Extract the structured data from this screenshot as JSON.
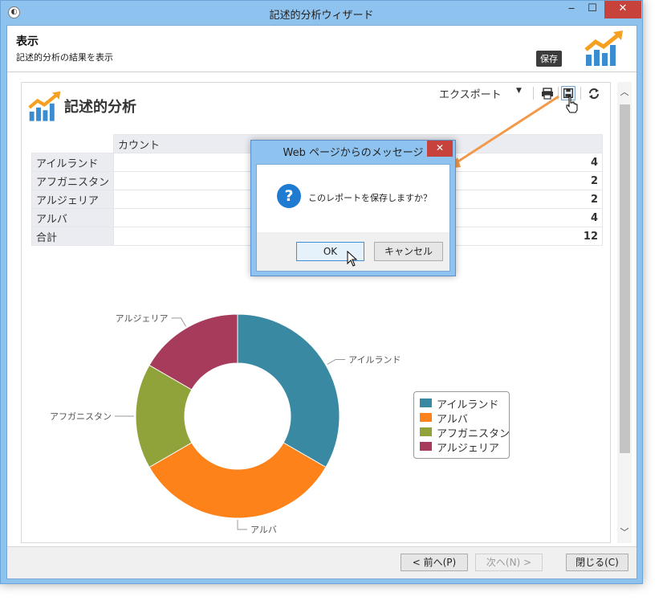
{
  "window": {
    "title": "記述的分析ウィザード",
    "minimize_glyph": "‒",
    "maximize_glyph": "☐",
    "close_glyph": "✕"
  },
  "header": {
    "title": "表示",
    "subtitle": "記述的分析の結果を表示",
    "logo_icon": "chart-trend-icon"
  },
  "toolbar": {
    "export_label": "エクスポート",
    "print_icon": "printer-icon",
    "save_icon": "floppy-disk-icon",
    "refresh_icon": "refresh-icon",
    "save_tooltip": "保存"
  },
  "report": {
    "title": "記述的分析",
    "column_header": "カウント",
    "rows": [
      {
        "label": "アイルランド",
        "value": "4"
      },
      {
        "label": "アフガニスタン",
        "value": "2"
      },
      {
        "label": "アルジェリア",
        "value": "2"
      },
      {
        "label": "アルバ",
        "value": "4"
      },
      {
        "label": "合計",
        "value": "12"
      }
    ]
  },
  "chart_data": {
    "type": "pie",
    "donut": true,
    "title": "",
    "categories": [
      "アイルランド",
      "アルバ",
      "アフガニスタン",
      "アルジェリア"
    ],
    "values": [
      4,
      4,
      2,
      2
    ],
    "colors": [
      "#3a89a3",
      "#fd8219",
      "#8fa33a",
      "#a63b5c"
    ],
    "legend_placement": "right"
  },
  "dialog": {
    "title": "Web ページからのメッセージ",
    "close_glyph": "✕",
    "message": "このレポートを保存しますか？",
    "ok_label": "OK",
    "cancel_label": "キャンセル"
  },
  "footer": {
    "prev_label": "< 前へ(P)",
    "next_label": "次へ(N) >",
    "close_label": "閉じる(C)"
  },
  "colors": {
    "accent": "#8fc3ef",
    "close_red": "#c7423a",
    "arrow_orange": "#f2994a"
  }
}
